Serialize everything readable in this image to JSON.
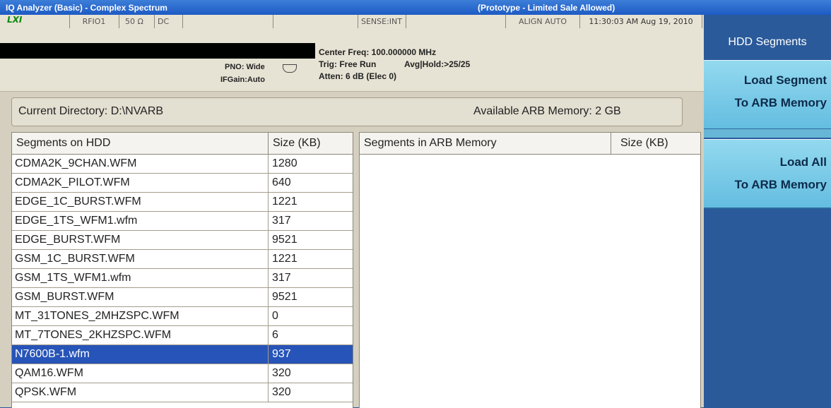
{
  "window": {
    "title": "IQ Analyzer (Basic) - Complex Spectrum",
    "notice": "(Prototype - Limited Sale Allowed)"
  },
  "status_bar": {
    "logo": "LXI",
    "input": "RFIO1",
    "impedance": "50 Ω",
    "coupling": "DC",
    "sense": "SENSE:INT",
    "align": "ALIGN AUTO",
    "datetime": "11:30:03 AM Aug 19, 2010"
  },
  "measurement": {
    "center_freq": "Center Freq: 100.000000 MHz",
    "trig": "Trig: Free Run",
    "avg_hold": "Avg|Hold:>25/25",
    "atten": "Atten: 6 dB (Elec 0)",
    "pno": "PNO: Wide",
    "ifgain": "IFGain:Auto"
  },
  "info": {
    "current_directory": "Current Directory: D:\\NVARB",
    "available_memory": "Available ARB Memory: 2 GB"
  },
  "hdd_panel": {
    "col_name": "Segments on HDD",
    "col_size": "Size (KB)",
    "rows": [
      {
        "name": "CDMA2K_9CHAN.WFM",
        "size": "1280"
      },
      {
        "name": "CDMA2K_PILOT.WFM",
        "size": "640"
      },
      {
        "name": "EDGE_1C_BURST.WFM",
        "size": "1221"
      },
      {
        "name": "EDGE_1TS_WFM1.wfm",
        "size": "317"
      },
      {
        "name": "EDGE_BURST.WFM",
        "size": "9521"
      },
      {
        "name": "GSM_1C_BURST.WFM",
        "size": "1221"
      },
      {
        "name": "GSM_1TS_WFM1.wfm",
        "size": "317"
      },
      {
        "name": "GSM_BURST.WFM",
        "size": "9521"
      },
      {
        "name": "MT_31TONES_2MHZSPC.WFM",
        "size": "0"
      },
      {
        "name": "MT_7TONES_2KHZSPC.WFM",
        "size": "6"
      },
      {
        "name": "N7600B-1.wfm",
        "size": "937"
      },
      {
        "name": "QAM16.WFM",
        "size": "320"
      },
      {
        "name": "QPSK.WFM",
        "size": "320"
      }
    ],
    "selected_index": 10
  },
  "arb_panel": {
    "col_name": "Segments in ARB Memory",
    "col_size": "Size (KB)"
  },
  "softkeys": {
    "menu_title": "HDD Segments",
    "load_segment_line1": "Load Segment",
    "load_segment_line2": "To ARB Memory",
    "load_all_line1": "Load All",
    "load_all_line2": "To ARB Memory"
  }
}
